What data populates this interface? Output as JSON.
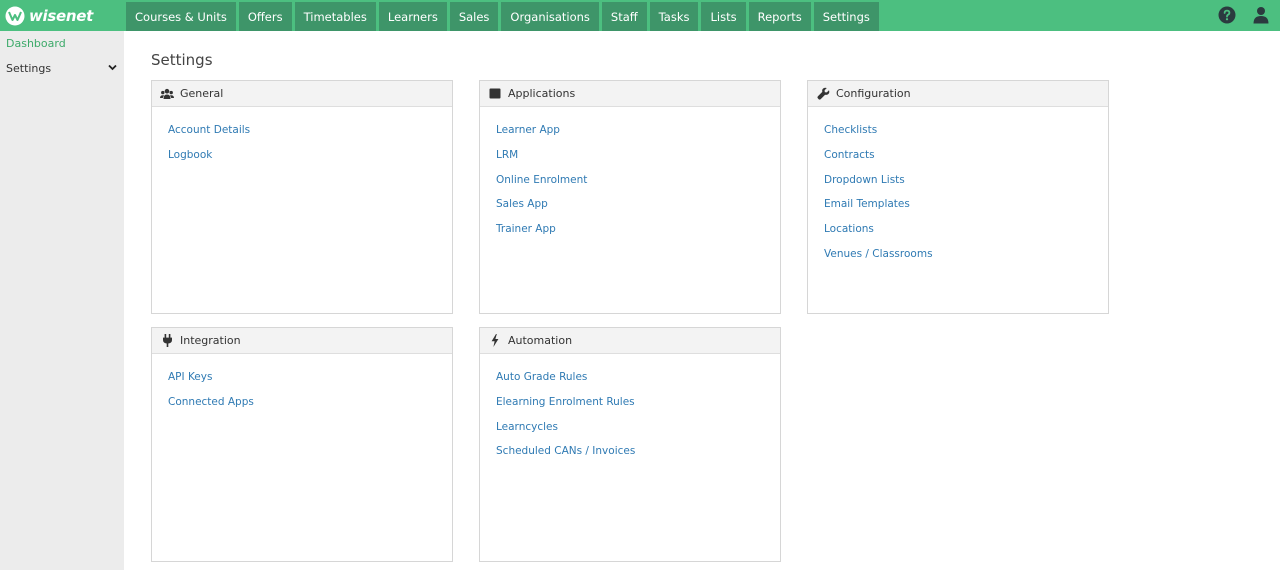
{
  "brand": {
    "name": "wisenet"
  },
  "nav": {
    "items": [
      {
        "label": "Courses & Units"
      },
      {
        "label": "Offers"
      },
      {
        "label": "Timetables"
      },
      {
        "label": "Learners"
      },
      {
        "label": "Sales"
      },
      {
        "label": "Organisations"
      },
      {
        "label": "Staff"
      },
      {
        "label": "Tasks"
      },
      {
        "label": "Lists"
      },
      {
        "label": "Reports"
      },
      {
        "label": "Settings"
      }
    ]
  },
  "sidebar": {
    "dashboard": "Dashboard",
    "settings": "Settings"
  },
  "page": {
    "title": "Settings"
  },
  "panels": {
    "general": {
      "title": "General",
      "links": [
        "Account Details",
        "Logbook"
      ]
    },
    "applications": {
      "title": "Applications",
      "links": [
        "Learner App",
        "LRM",
        "Online Enrolment",
        "Sales App",
        "Trainer App"
      ]
    },
    "configuration": {
      "title": "Configuration",
      "links": [
        "Checklists",
        "Contracts",
        "Dropdown Lists",
        "Email Templates",
        "Locations",
        "Venues / Classrooms"
      ]
    },
    "integration": {
      "title": "Integration",
      "links": [
        "API Keys",
        "Connected Apps"
      ]
    },
    "automation": {
      "title": "Automation",
      "links": [
        "Auto Grade Rules",
        "Elearning Enrolment Rules",
        "Learncycles",
        "Scheduled CANs / Invoices"
      ]
    }
  },
  "colors": {
    "accent": "#4cbf80",
    "nav_tab": "#3e9569",
    "link": "#2f7ab3"
  }
}
